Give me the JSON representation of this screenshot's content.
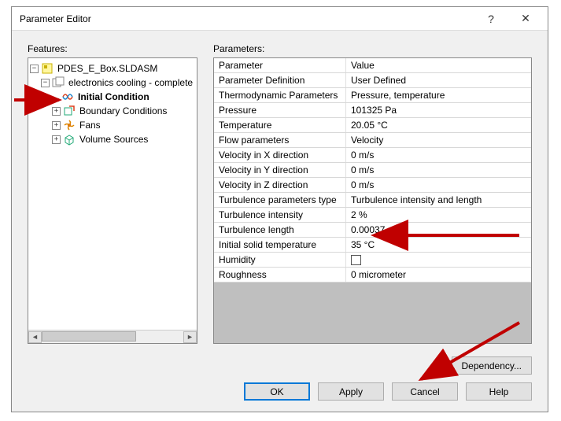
{
  "window": {
    "title": "Parameter Editor"
  },
  "labels": {
    "features": "Features:",
    "parameters": "Parameters:"
  },
  "tree": {
    "root": "PDES_E_Box.SLDASM",
    "project": "electronics cooling - complete",
    "items": {
      "initial_condition": "Initial Condition",
      "boundary_conditions": "Boundary Conditions",
      "fans": "Fans",
      "volume_sources": "Volume Sources"
    }
  },
  "expanders": {
    "minus": "−",
    "plus": "+"
  },
  "scroll_arrows": {
    "left": "◄",
    "right": "►"
  },
  "grid": {
    "header": {
      "name": "Parameter",
      "value": "Value"
    },
    "rows": [
      {
        "name": "Parameter Definition",
        "value": "User Defined"
      },
      {
        "name": "Thermodynamic Parameters",
        "value": "Pressure, temperature"
      },
      {
        "name": "Pressure",
        "value": "101325 Pa"
      },
      {
        "name": "Temperature",
        "value": "20.05 °C"
      },
      {
        "name": "Flow parameters",
        "value": "Velocity"
      },
      {
        "name": "Velocity in X direction",
        "value": "0 m/s"
      },
      {
        "name": "Velocity in Y direction",
        "value": "0 m/s"
      },
      {
        "name": "Velocity in Z direction",
        "value": "0 m/s"
      },
      {
        "name": "Turbulence parameters type",
        "value": "Turbulence intensity and length"
      },
      {
        "name": "Turbulence intensity",
        "value": "2 %"
      },
      {
        "name": "Turbulence length",
        "value": "0.00037 m"
      },
      {
        "name": "Initial solid temperature",
        "value": "35 °C"
      },
      {
        "name": "Humidity",
        "value": "",
        "checkbox": true
      },
      {
        "name": "Roughness",
        "value": "0 micrometer"
      }
    ]
  },
  "buttons": {
    "dependency": "Dependency...",
    "ok": "OK",
    "apply": "Apply",
    "cancel": "Cancel",
    "help": "Help"
  }
}
